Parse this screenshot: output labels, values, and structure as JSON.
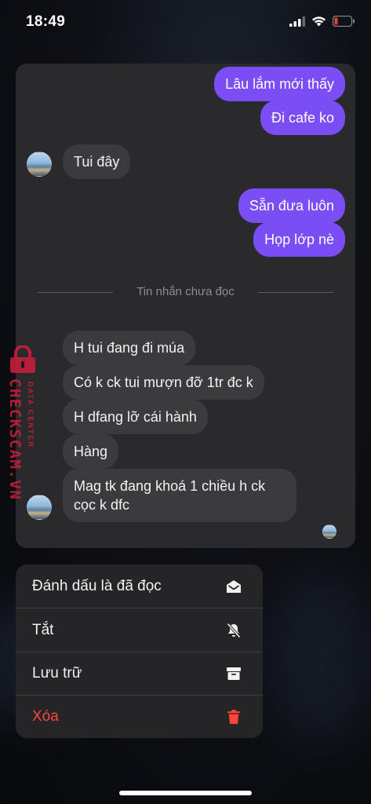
{
  "status_bar": {
    "time": "18:49"
  },
  "conversation": {
    "messages_before": [
      {
        "id": "m1",
        "direction": "out",
        "text": "Lâu lắm mới thấy"
      },
      {
        "id": "m2",
        "direction": "out",
        "text": "Đi cafe ko"
      },
      {
        "id": "m3",
        "direction": "in",
        "text": "Tui đây"
      },
      {
        "id": "m4",
        "direction": "out",
        "text": "Sẵn đưa luôn"
      },
      {
        "id": "m5",
        "direction": "out",
        "text": "Họp lớp nè"
      }
    ],
    "unread_divider": "Tin nhắn chưa đọc",
    "messages_after": [
      {
        "id": "m6",
        "direction": "in",
        "text": "H tui đang đi múa"
      },
      {
        "id": "m7",
        "direction": "in",
        "text": "Có k ck tui mượn đỡ 1tr đc k"
      },
      {
        "id": "m8",
        "direction": "in",
        "text": "H dfang lỡ cái hành"
      },
      {
        "id": "m9",
        "direction": "in",
        "text": "Hàng"
      },
      {
        "id": "m10",
        "direction": "in",
        "text": "Mag tk đang khoá 1 chiều h ck cọc k dfc"
      }
    ]
  },
  "watermark": {
    "brand": "CHECKSCAM.VN",
    "subtitle": "DATA CENTER",
    "color": "#d01e3c"
  },
  "context_menu": {
    "items": [
      {
        "label": "Đánh dấu là đã đọc",
        "icon": "mark-read-envelope-icon",
        "danger": false
      },
      {
        "label": "Tắt",
        "icon": "bell-slash-icon",
        "danger": false
      },
      {
        "label": "Lưu trữ",
        "icon": "archive-box-icon",
        "danger": false
      },
      {
        "label": "Xóa",
        "icon": "trash-icon",
        "danger": true
      }
    ]
  },
  "colors": {
    "outgoing_bubble": "#7a4df5",
    "incoming_bubble": "#3b3b3e",
    "danger": "#ff453a",
    "card_background": "#2a2a2c"
  }
}
